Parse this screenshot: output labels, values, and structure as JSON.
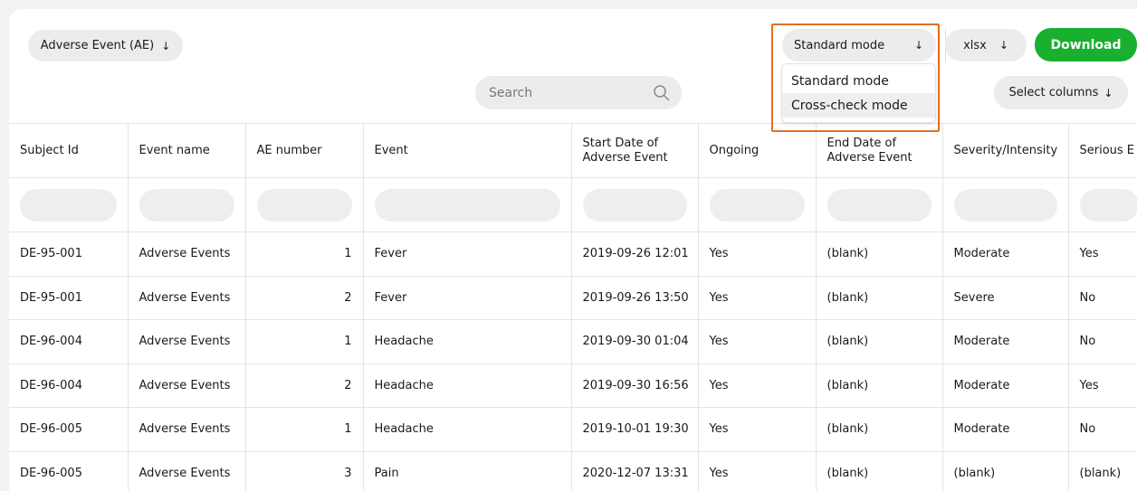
{
  "toolbar": {
    "form_select": "Adverse Event (AE)",
    "mode_select": "Standard mode",
    "format_select": "xlsx",
    "download_label": "Download",
    "search_placeholder": "Search",
    "select_columns": "Select columns"
  },
  "mode_dropdown": {
    "options": [
      "Standard mode",
      "Cross-check mode"
    ],
    "hovered": "Cross-check mode"
  },
  "arrow_glyph": "↓",
  "table": {
    "columns": [
      "Subject Id",
      "Event name",
      "AE number",
      "Event",
      "Start Date of Adverse Event",
      "Ongoing",
      "End Date of Adverse Event",
      "Severity/Intensity",
      "Serious E"
    ],
    "rows": [
      [
        "DE-95-001",
        "Adverse Events",
        "1",
        "Fever",
        "2019-09-26 12:01",
        "Yes",
        "(blank)",
        "Moderate",
        "Yes"
      ],
      [
        "DE-95-001",
        "Adverse Events",
        "2",
        "Fever",
        "2019-09-26 13:50",
        "Yes",
        "(blank)",
        "Severe",
        "No"
      ],
      [
        "DE-96-004",
        "Adverse Events",
        "1",
        "Headache",
        "2019-09-30 01:04",
        "Yes",
        "(blank)",
        "Moderate",
        "No"
      ],
      [
        "DE-96-004",
        "Adverse Events",
        "2",
        "Headache",
        "2019-09-30 16:56",
        "Yes",
        "(blank)",
        "Moderate",
        "Yes"
      ],
      [
        "DE-96-005",
        "Adverse Events",
        "1",
        "Headache",
        "2019-10-01 19:30",
        "Yes",
        "(blank)",
        "Moderate",
        "No"
      ],
      [
        "DE-96-005",
        "Adverse Events",
        "3",
        "Pain",
        "2020-12-07 13:31",
        "Yes",
        "(blank)",
        "(blank)",
        "(blank)"
      ]
    ]
  },
  "colors": {
    "download": "#19b02f",
    "highlight": "#e36d25"
  }
}
